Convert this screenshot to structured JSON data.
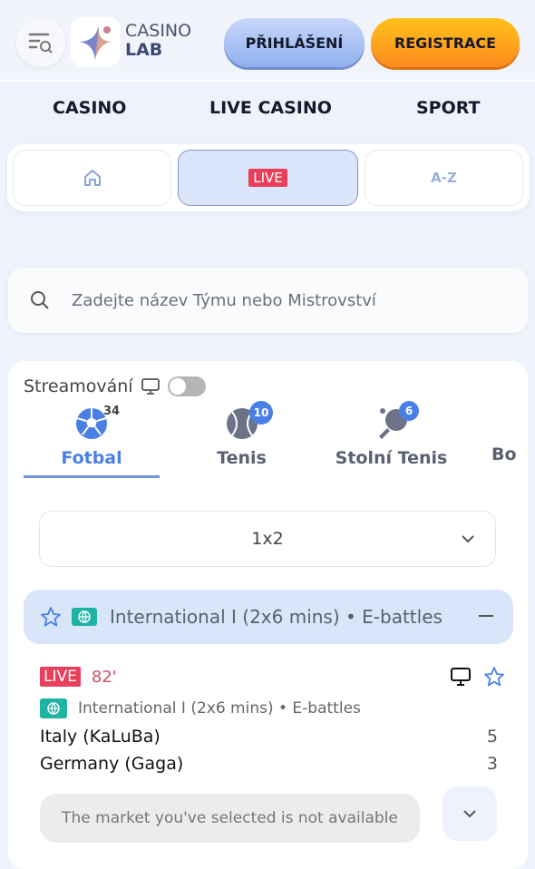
{
  "header": {
    "logo": {
      "line1": "CASINO",
      "line2": "LAB"
    },
    "login_label": "PŘIHLÁŠENÍ",
    "register_label": "REGISTRACE"
  },
  "nav": [
    {
      "label": "CASINO"
    },
    {
      "label": "LIVE CASINO"
    },
    {
      "label": "SPORT"
    }
  ],
  "segments": {
    "live_label": "LIVE",
    "az_label": "A-Z",
    "active": "live"
  },
  "search": {
    "placeholder": "Zadejte název Týmu nebo Mistrovství"
  },
  "streaming": {
    "label": "Streamování",
    "enabled": false
  },
  "sports": [
    {
      "label": "Fotbal",
      "count": "34",
      "active": true
    },
    {
      "label": "Tenis",
      "count": "10"
    },
    {
      "label": "Stolní Tenis",
      "count": "6"
    },
    {
      "label": "Bo"
    }
  ],
  "market_select": {
    "value": "1x2"
  },
  "league": {
    "name": "International I (2x6 mins) • E-battles"
  },
  "match": {
    "live_label": "LIVE",
    "minute": "82'",
    "league": "International I (2x6 mins) • E-battles",
    "teams": [
      {
        "name": "Italy (KaLuBa)",
        "score": "5"
      },
      {
        "name": "Germany (Gaga)",
        "score": "3"
      }
    ],
    "market_message": "The market you've selected is not available"
  },
  "colors": {
    "accent": "#4a80e6",
    "live": "#e8405b",
    "register": "#ff9f1a",
    "league_bg": "#d9e5f9"
  }
}
